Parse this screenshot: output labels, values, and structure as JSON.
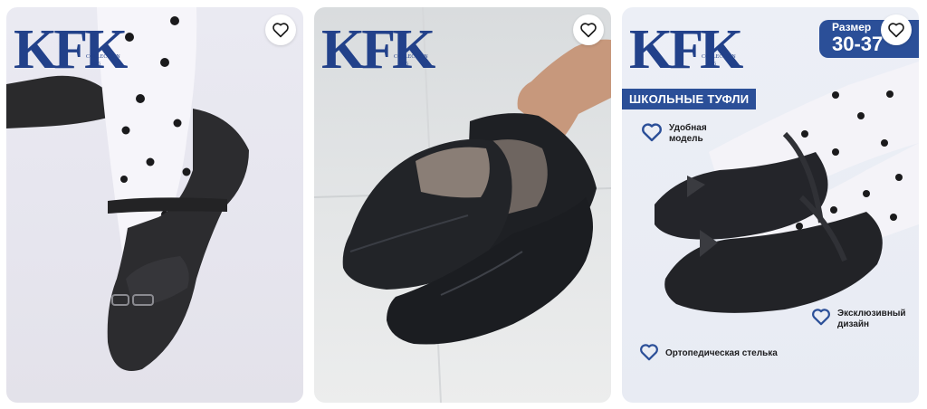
{
  "brand": {
    "mark": "KFK",
    "sub_line_1": "COLLECTION",
    "sub_line_2": "1996",
    "color": "#22418a"
  },
  "accent": "#2b4f98",
  "cards": [
    {
      "id": "card-1",
      "favorite_icon": "heart-outline-icon"
    },
    {
      "id": "card-2",
      "favorite_icon": "heart-outline-icon"
    },
    {
      "id": "card-3",
      "favorite_icon": "heart-outline-icon",
      "title": "ШКОЛЬНЫЕ ТУФЛИ",
      "size_label": "Размер",
      "size_value": "30-37",
      "features": [
        {
          "icon": "heart-icon",
          "text": "Удобная модель"
        },
        {
          "icon": "heart-icon",
          "text": "Эксклюзивный дизайн"
        },
        {
          "icon": "heart-icon",
          "text": "Ортопедическая стелька"
        }
      ]
    }
  ]
}
